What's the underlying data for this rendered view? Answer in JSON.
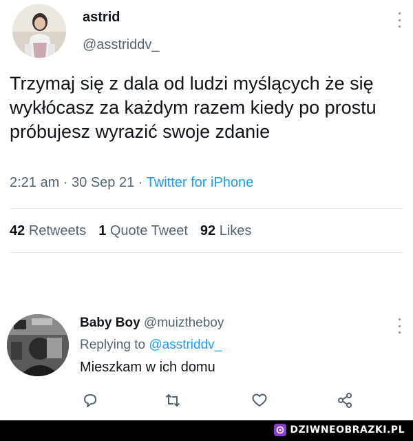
{
  "tweet": {
    "display_name": "astrid",
    "handle": "@asstriddv_",
    "text": "Trzymaj się z dala od ludzi myślących że się wykłócasz za każdym razem kiedy po prostu próbujesz wyrazić swoje zdanie",
    "timestamp": "2:21 am · 30 Sep 21 · ",
    "source": "Twitter for iPhone",
    "stats": {
      "retweets_count": "42",
      "retweets_label": "Retweets",
      "quotes_count": "1",
      "quotes_label": "Quote Tweet",
      "likes_count": "92",
      "likes_label": "Likes"
    }
  },
  "reply": {
    "display_name": "Baby Boy",
    "handle": "@muiztheboy",
    "replying_prefix": "Replying to ",
    "replying_to": "@asstriddv_",
    "text": "Mieszkam w ich domu"
  },
  "icons": {
    "more": "more-vertical-icon",
    "reply": "comment-icon",
    "retweet": "retweet-icon",
    "like": "heart-icon",
    "share": "share-icon"
  },
  "colors": {
    "text": "#0f1419",
    "secondary": "#536471",
    "link": "#1d9bf0",
    "watermark_badge": "#8e3fd1"
  },
  "watermark": {
    "text": "DZIWNEOBRAZKI.PL"
  }
}
